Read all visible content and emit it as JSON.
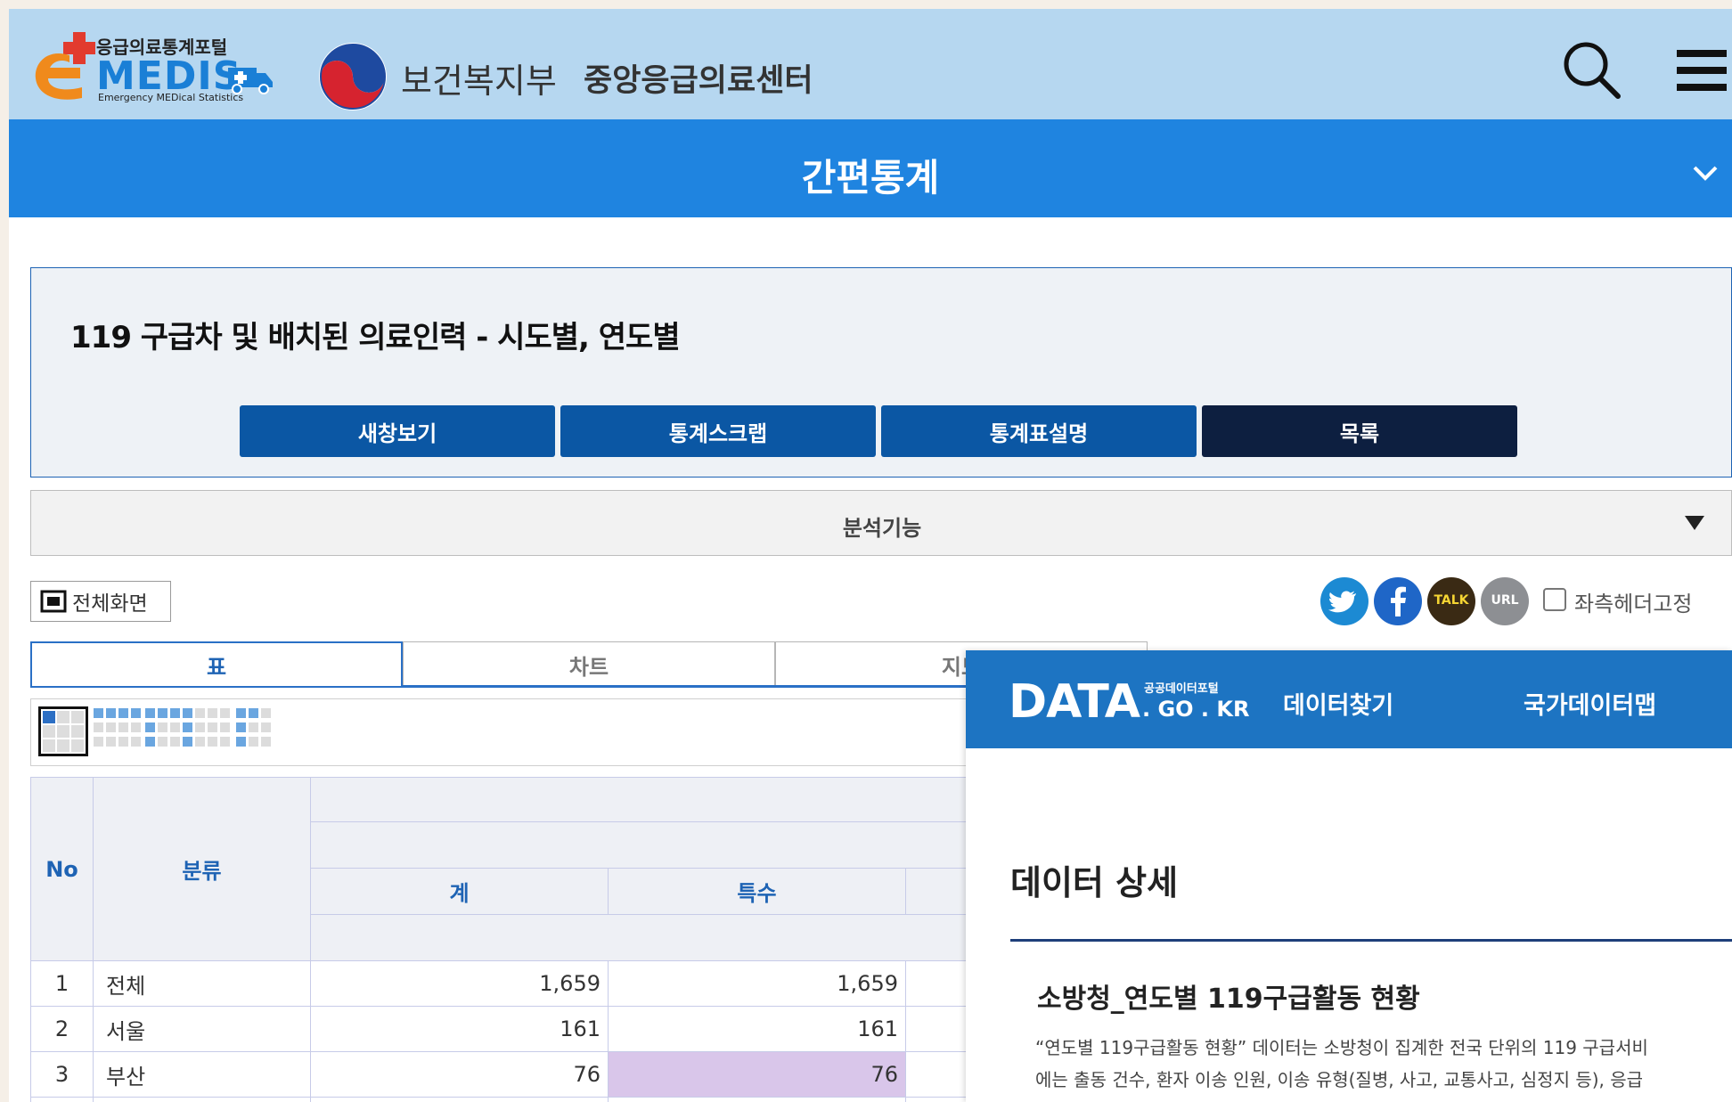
{
  "header": {
    "portal_name": "응급의료통계포털",
    "medis_logo": "MEDIS",
    "medis_tagline": "Emergency MEDical Statistics",
    "ministry": "보건복지부",
    "center": "중앙응급의료센터"
  },
  "titlebar": {
    "title": "간편통계"
  },
  "stat": {
    "title": "119 구급차 및 배치된 의료인력 - 시도별, 연도별",
    "buttons": [
      "새창보기",
      "통계스크랩",
      "통계표설명",
      "목록"
    ]
  },
  "analysis": {
    "label": "분석기능"
  },
  "toolbar": {
    "fullscreen": "전체화면",
    "share": {
      "talk": "TALK",
      "url": "URL"
    },
    "fix_header": "좌측헤더고정"
  },
  "tabs": [
    "표",
    "차트",
    "지도"
  ],
  "colors": {
    "accent": "#1f84e0",
    "header_bg": "#b6d7f0",
    "button": "#0b57a4",
    "button_dark": "#0d1f40",
    "highlight": "#d9c6ea"
  },
  "table": {
    "headers": {
      "no": "No",
      "category": "분류",
      "total": "계",
      "special": "특수"
    },
    "rows": [
      {
        "no": "1",
        "cat": "전체",
        "total": "1,659",
        "special": "1,659"
      },
      {
        "no": "2",
        "cat": "서울",
        "total": "161",
        "special": "161"
      },
      {
        "no": "3",
        "cat": "부산",
        "total": "76",
        "special": "76"
      }
    ]
  },
  "datagokr": {
    "logo": "DATA",
    "logo_small": "공공데이터포털",
    "logo_domain": ". GO . KR",
    "nav": [
      "데이터찾기",
      "국가데이터맵"
    ],
    "detail_title": "데이터 상세",
    "dataset_title": "소방청_연도별 119구급활동 현황",
    "desc_lines": [
      "“연도별 119구급활동 현황” 데이터는 소방청이 집계한 전국 단위의 119 구급서비",
      "에는 출동 건수, 환자 이송 인원, 이송 유형(질병, 사고, 교통사고, 심정지 등), 응급"
    ]
  }
}
